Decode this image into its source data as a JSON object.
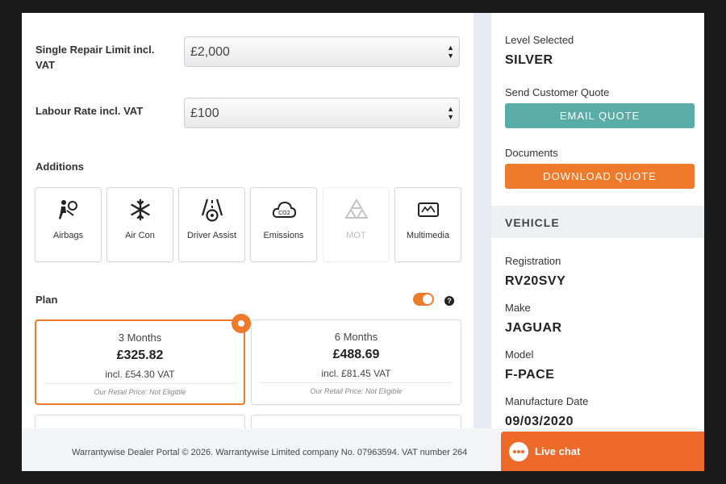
{
  "form": {
    "repair_limit_label": "Single Repair Limit incl. VAT",
    "repair_limit_value": "£2,000",
    "labour_rate_label": "Labour Rate incl. VAT",
    "labour_rate_value": "£100"
  },
  "additions": {
    "heading": "Additions",
    "items": [
      {
        "label": "Airbags",
        "icon": "airbag-icon",
        "enabled": true
      },
      {
        "label": "Air Con",
        "icon": "snowflake-icon",
        "enabled": true
      },
      {
        "label": "Driver Assist",
        "icon": "driver-assist-icon",
        "enabled": true
      },
      {
        "label": "Emissions",
        "icon": "co2-cloud-icon",
        "enabled": true
      },
      {
        "label": "MOT",
        "icon": "mot-triangle-icon",
        "enabled": false
      },
      {
        "label": "Multimedia",
        "icon": "multimedia-icon",
        "enabled": true
      }
    ]
  },
  "plan": {
    "heading": "Plan",
    "help": "?",
    "toggle_on": true,
    "options": [
      {
        "duration": "3 Months",
        "price": "£325.82",
        "vat": "incl. £54.30 VAT",
        "retail": "Our Retail Price: Not Eligible",
        "selected": true
      },
      {
        "duration": "6 Months",
        "price": "£488.69",
        "vat": "incl. £81.45 VAT",
        "retail": "Our Retail Price: Not Eligible",
        "selected": false
      }
    ]
  },
  "summary": {
    "level_label": "Level Selected",
    "level_value": "SILVER",
    "quote_label": "Send Customer Quote",
    "email_button": "EMAIL QUOTE",
    "documents_label": "Documents",
    "download_button": "DOWNLOAD QUOTE"
  },
  "vehicle": {
    "heading": "VEHICLE",
    "registration_label": "Registration",
    "registration_value": "RV20SVY",
    "make_label": "Make",
    "make_value": "JAGUAR",
    "model_label": "Model",
    "model_value": "F-PACE",
    "manufacture_label": "Manufacture Date",
    "manufacture_value": "09/03/2020"
  },
  "footer": {
    "text": "Warrantywise Dealer Portal © 2026. Warrantywise Limited company No. 07963594. VAT number 264"
  },
  "livechat": {
    "label": "Live chat"
  },
  "colors": {
    "accent_orange": "#ee7a2c",
    "email_teal": "#5aaca6",
    "divider": "#e7ebf3"
  }
}
